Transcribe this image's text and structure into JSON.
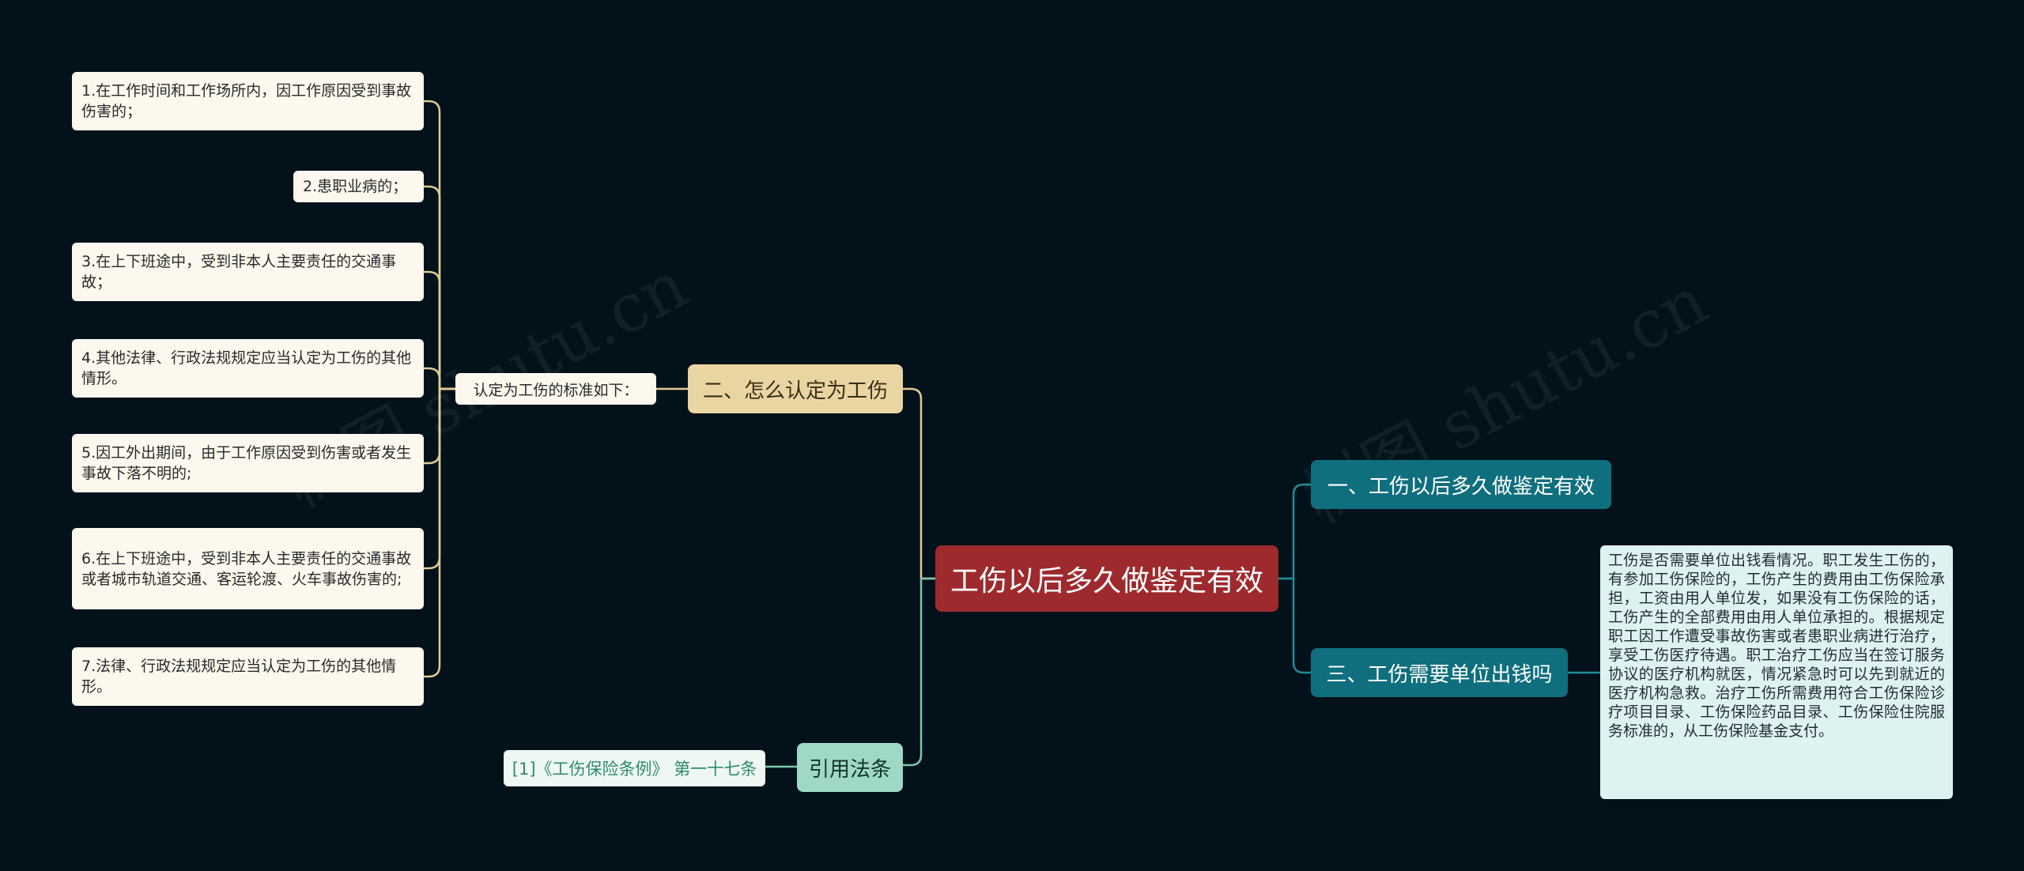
{
  "root": {
    "label": "工伤以后多久做鉴定有效"
  },
  "branches": {
    "b1": {
      "label": "一、工伤以后多久做鉴定有效"
    },
    "b2": {
      "label": "二、怎么认定为工伤",
      "intro": "认定为工伤的标准如下：",
      "items": [
        "1.在工作时间和工作场所内，因工作原因受到事故伤害的；",
        "2.患职业病的；",
        "3.在上下班途中，受到非本人主要责任的交通事故；",
        "4.其他法律、行政法规规定应当认定为工伤的其他情形。",
        "5.因工外出期间，由于工作原因受到伤害或者发生事故下落不明的;",
        "6.在上下班途中，受到非本人主要责任的交通事故或者城市轨道交通、客运轮渡、火车事故伤害的;",
        "7.法律、行政法规规定应当认定为工伤的其他情形。"
      ]
    },
    "b3": {
      "label": "三、工伤需要单位出钱吗",
      "detail": "工伤是否需要单位出钱看情况。职工发生工伤的，有参加工伤保险的，工伤产生的费用由工伤保险承担，工资由用人单位发，如果没有工伤保险的话，工伤产生的全部费用由用人单位承担的。根据规定职工因工作遭受事故伤害或者患职业病进行治疗，享受工伤医疗待遇。职工治疗工伤应当在签订服务协议的医疗机构就医，情况紧急时可以先到就近的医疗机构急救。治疗工伤所需费用符合工伤保险诊疗项目目录、工伤保险药品目录、工伤保险住院服务标准的，从工伤保险基金支付。"
    },
    "b4": {
      "label": "引用法条",
      "ref": "[1]《工伤保险条例》 第一十七条"
    }
  },
  "watermark": {
    "text": "树图 shutu.cn"
  },
  "colors": {
    "background": "#03111a",
    "root": "#9e2a2d",
    "branch_tan": "#e8d5a2",
    "branch_teal": "#0f6f7e",
    "branch_green": "#9fd8c4",
    "line_tan": "#e0cc93",
    "line_teal": "#1f8b97",
    "line_green": "#7cc6ae"
  }
}
